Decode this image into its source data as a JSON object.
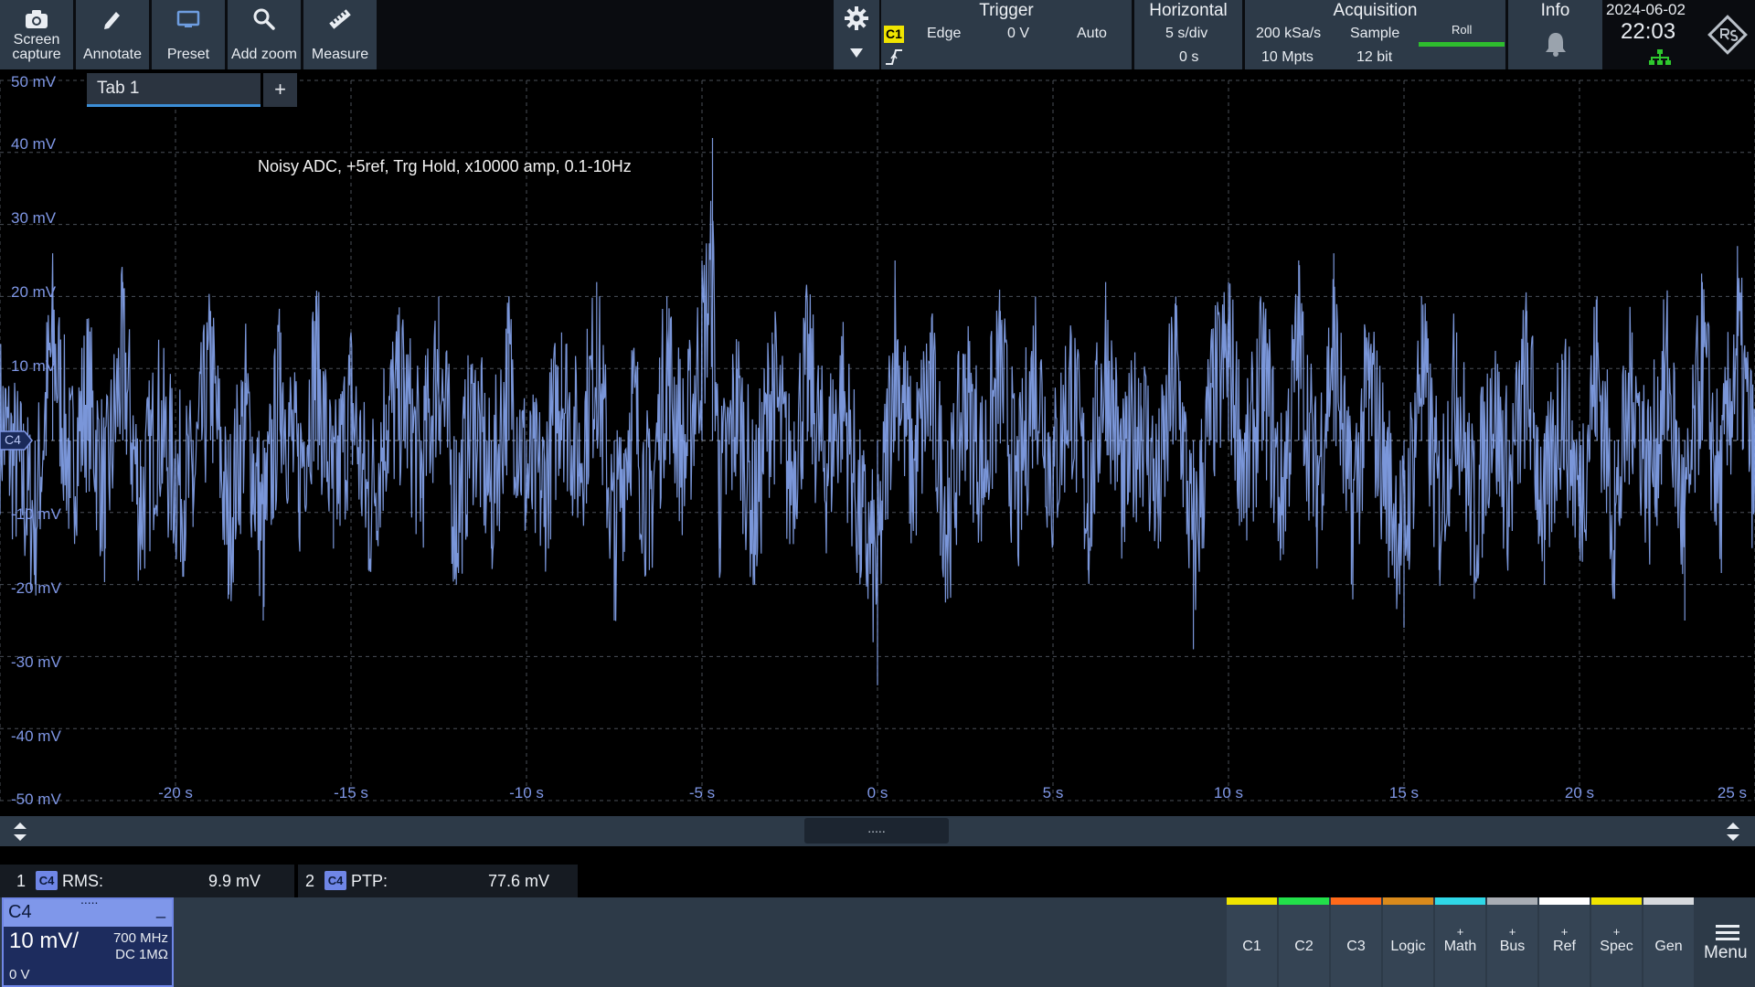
{
  "toolbar": {
    "screen_capture": "Screen capture",
    "annotate": "Annotate",
    "preset": "Preset",
    "add_zoom": "Add zoom",
    "measure": "Measure"
  },
  "trigger": {
    "title": "Trigger",
    "source": "C1",
    "type": "Edge",
    "level": "0 V",
    "mode": "Auto"
  },
  "horizontal": {
    "title": "Horizontal",
    "scale": "5 s/div",
    "position": "0 s"
  },
  "acquisition": {
    "title": "Acquisition",
    "rate": "200 kSa/s",
    "mode": "Sample",
    "roll": "Roll",
    "points": "10 Mpts",
    "resolution": "12 bit"
  },
  "info": {
    "title": "Info"
  },
  "datetime": {
    "date": "2024-06-02",
    "time": "22:03"
  },
  "tabs": {
    "tab1": "Tab 1",
    "add": "+"
  },
  "annotation_text": "Noisy ADC, +5ref, Trg Hold, x10000 amp, 0.1-10Hz",
  "y_labels": [
    "50 mV",
    "40 mV",
    "30 mV",
    "20 mV",
    "10 mV",
    "",
    "-10 mV",
    "-20 mV",
    "-30 mV",
    "-40 mV",
    "-50 mV"
  ],
  "x_labels": [
    "-20 s",
    "-15 s",
    "-10 s",
    "-5 s",
    "0 s",
    "5 s",
    "10 s",
    "15 s",
    "20 s",
    "25 s"
  ],
  "channel_marker": "C4",
  "splitter": {
    "grip": "....."
  },
  "measurements": {
    "m1": {
      "index": "1",
      "channel": "C4",
      "label": "RMS:",
      "value": "9.9 mV"
    },
    "m2": {
      "index": "2",
      "channel": "C4",
      "label": "PTP:",
      "value": "77.6 mV"
    }
  },
  "channel_panel": {
    "name": "C4",
    "dots": ".....",
    "minimize": "_",
    "scale": "10 mV/",
    "bandwidth": "700 MHz",
    "coupling": "DC 1MΩ",
    "offset": "0 V"
  },
  "bottom_buttons": [
    {
      "plus": "",
      "label": "C1",
      "color": "#f0e400"
    },
    {
      "plus": "",
      "label": "C2",
      "color": "#22e04a"
    },
    {
      "plus": "",
      "label": "C3",
      "color": "#ff6a1a"
    },
    {
      "plus": "",
      "label": "Logic",
      "color": "#d98a1c"
    },
    {
      "plus": "+",
      "label": "Math",
      "color": "#2fd8e8"
    },
    {
      "plus": "+",
      "label": "Bus",
      "color": "#a8adb4"
    },
    {
      "plus": "+",
      "label": "Ref",
      "color": "#ffffff"
    },
    {
      "plus": "+",
      "label": "Spec",
      "color": "#f0e400"
    },
    {
      "plus": "",
      "label": "Gen",
      "color": "#d6d9dd"
    }
  ],
  "menu": {
    "label": "Menu"
  },
  "colors": {
    "trace": "#8fb0ff",
    "grid": "#4a4f58",
    "accent": "#3c8ed6"
  },
  "chart_data": {
    "type": "line",
    "xlim": [
      -25,
      25
    ],
    "ylim": [
      -50,
      50
    ],
    "xlabel": "",
    "ylabel": "",
    "series": [
      {
        "x": [
          -25,
          -24,
          -23.5,
          -23,
          -22.5,
          -22,
          -21.5,
          -21,
          -20.5,
          -20,
          -19.5,
          -19,
          -18.5,
          -18,
          -17.5,
          -17,
          -16.5,
          -16,
          -15.5,
          -15,
          -14.5,
          -14,
          -13.5,
          -13,
          -12.5,
          -12,
          -11.5,
          -11,
          -10.5,
          -10,
          -9.5,
          -9,
          -8.5,
          -8,
          -7.5,
          -7,
          -6.5,
          -6,
          -5.5,
          -5,
          -4.7,
          -4.5,
          -4,
          -3.5,
          -3,
          -2.5,
          -2,
          -1.5,
          -1,
          -0.5,
          0,
          0.5,
          1,
          1.5,
          2,
          2.5,
          3,
          3.5,
          4,
          4.5,
          5,
          5.5,
          6,
          6.5,
          7,
          7.5,
          8,
          8.5,
          9,
          9.5,
          10,
          10.5,
          11,
          11.5,
          12,
          12.5,
          13,
          13.5,
          14,
          14.5,
          15,
          15.5,
          16,
          16.5,
          17,
          17.5,
          18,
          18.5,
          19,
          19.5,
          20,
          20.5,
          21,
          21.5,
          22,
          22.5,
          23,
          23.5,
          24,
          24.5,
          25
        ],
        "y": [
          5,
          -20,
          26,
          -8,
          12,
          -15,
          22,
          -18,
          5,
          -10,
          -12,
          18,
          -22,
          8,
          -25,
          15,
          -10,
          20,
          -15,
          10,
          -18,
          5,
          12,
          -8,
          20,
          -20,
          8,
          -15,
          18,
          -10,
          -12,
          15,
          -5,
          22,
          -25,
          10,
          -18,
          20,
          -5,
          25,
          42,
          -15,
          10,
          -20,
          15,
          -10,
          18,
          -8,
          12,
          -20,
          -34,
          25,
          -10,
          15,
          -22,
          12,
          -8,
          18,
          -15,
          20,
          -10,
          15,
          -18,
          22,
          -12,
          8,
          -15,
          20,
          -29,
          8,
          22,
          -10,
          18,
          -15,
          25,
          -12,
          26,
          -20,
          15,
          -10,
          -26,
          20,
          -18,
          15,
          -22,
          10,
          -12,
          18,
          -20,
          12,
          -15,
          20,
          -22,
          15,
          -10,
          18,
          -25,
          22,
          -15,
          27,
          -10
        ]
      }
    ],
    "grid": true
  }
}
